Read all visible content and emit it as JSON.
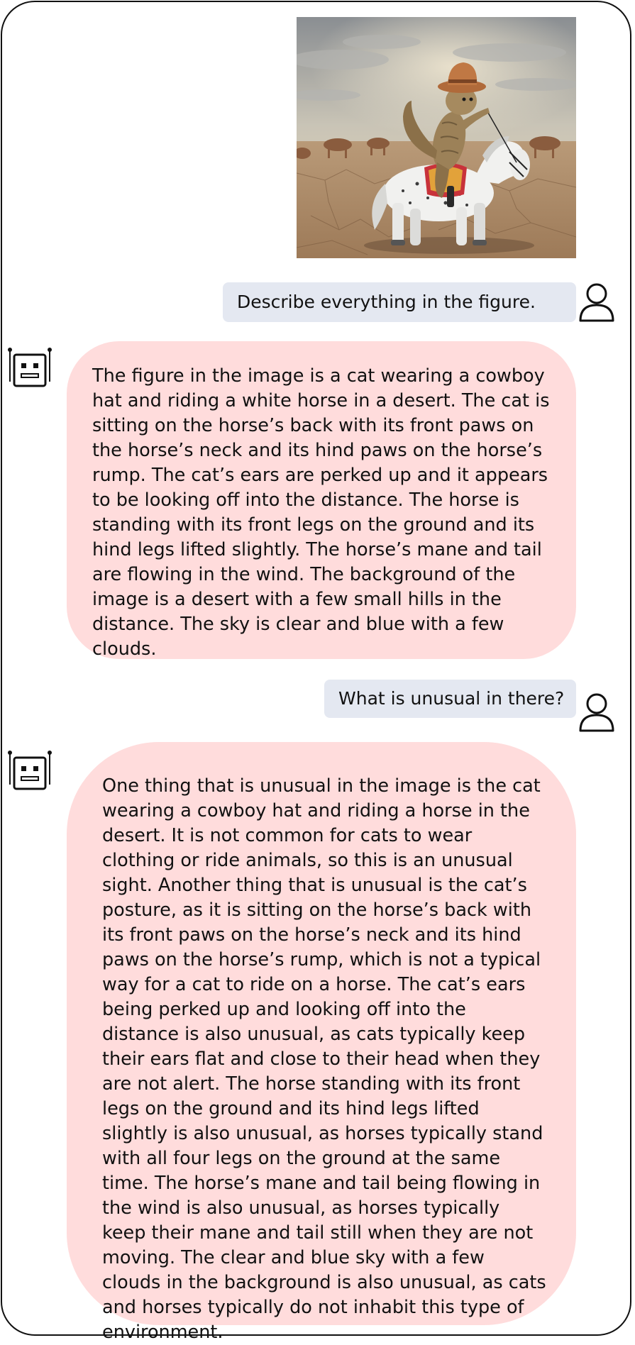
{
  "image": {
    "description_icon": "cat-cowboy-riding-horse-photo"
  },
  "conversation": {
    "q1": "Describe everything in the figure.",
    "r1": "The figure in the image is a cat wearing a cowboy hat and riding a white horse in a desert. The cat is sitting on the horse’s back with its front paws on the horse’s neck and its hind paws on the horse’s rump. The cat’s ears are perked up and it appears to be looking off into the distance. The horse is standing with its front legs on the ground and its hind legs lifted slightly. The horse’s mane and tail are flowing in the wind. The background of the image is a desert with a few small hills in the distance. The sky is clear and blue with a few clouds.",
    "q2": "What is unusual in there?",
    "r2": "One thing that is unusual in the image is the cat wearing a cowboy hat and riding a horse in the desert. It is not common for cats to wear clothing or ride animals, so this is an unusual sight. Another thing that is unusual is the cat’s posture, as it is sitting on the horse’s back with its front paws on the horse’s neck and its hind paws on the horse’s rump, which is not a typical way for a cat to ride on a horse. The cat’s ears being perked up and looking off into the distance is also unusual, as cats typically keep their ears flat and close to their head when they are not alert. The horse standing with its front legs on the ground and its hind legs lifted slightly is also unusual, as horses typically stand with all four legs on the ground at the same time. The horse’s mane and tail being flowing in the wind is also unusual, as horses typically keep their mane and tail still when they are not moving. The clear and blue sky with a few clouds in the background is also unusual, as cats and horses typically do not inhabit this type of environment."
  },
  "icons": {
    "user": "user-icon",
    "bot": "robot-icon"
  },
  "colors": {
    "user_bubble": "#e4e8f1",
    "bot_bubble": "#ffdcdc",
    "border": "#111111"
  }
}
